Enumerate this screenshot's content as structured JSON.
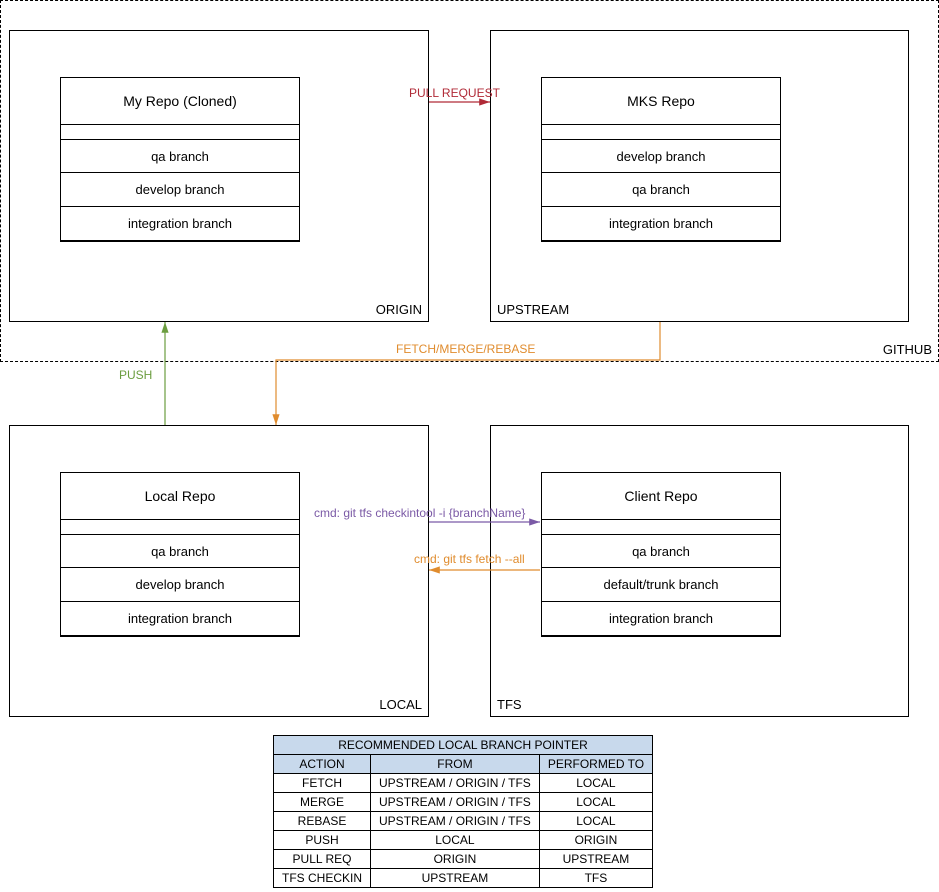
{
  "github": {
    "label": "GITHUB",
    "origin": {
      "label": "ORIGIN",
      "repo": {
        "title": "My Repo (Cloned)",
        "branches": [
          "qa branch",
          "develop branch",
          "integration branch"
        ]
      }
    },
    "upstream": {
      "label": "UPSTREAM",
      "repo": {
        "title": "MKS Repo",
        "branches": [
          "develop branch",
          "qa branch",
          "integration branch"
        ]
      }
    }
  },
  "local": {
    "label": "LOCAL",
    "repo": {
      "title": "Local Repo",
      "branches": [
        "qa branch",
        "develop branch",
        "integration branch"
      ]
    }
  },
  "tfs": {
    "label": "TFS",
    "repo": {
      "title": "Client Repo",
      "branches": [
        "qa branch",
        "default/trunk branch",
        "integration branch"
      ]
    }
  },
  "arrows": {
    "pull_request": "PULL REQUEST",
    "fetch_merge_rebase": "FETCH/MERGE/REBASE",
    "push": "PUSH",
    "checkin_cmd": "cmd: git tfs checkintool -i {branchName}",
    "fetch_cmd": "cmd: git tfs fetch --all"
  },
  "table": {
    "title": "RECOMMENDED LOCAL BRANCH POINTER",
    "headers": [
      "ACTION",
      "FROM",
      "PERFORMED TO"
    ],
    "rows": [
      [
        "FETCH",
        "UPSTREAM / ORIGIN / TFS",
        "LOCAL"
      ],
      [
        "MERGE",
        "UPSTREAM / ORIGIN / TFS",
        "LOCAL"
      ],
      [
        "REBASE",
        "UPSTREAM / ORIGIN / TFS",
        "LOCAL"
      ],
      [
        "PUSH",
        "LOCAL",
        "ORIGIN"
      ],
      [
        "PULL REQ",
        "ORIGIN",
        "UPSTREAM"
      ],
      [
        "TFS CHECKIN",
        "UPSTREAM",
        "TFS"
      ]
    ]
  },
  "colors": {
    "red": "#b02a37",
    "orange": "#e08c2e",
    "green": "#6b9d3f",
    "purple": "#7b5aa6",
    "tableHeader": "#c8d9ec"
  }
}
